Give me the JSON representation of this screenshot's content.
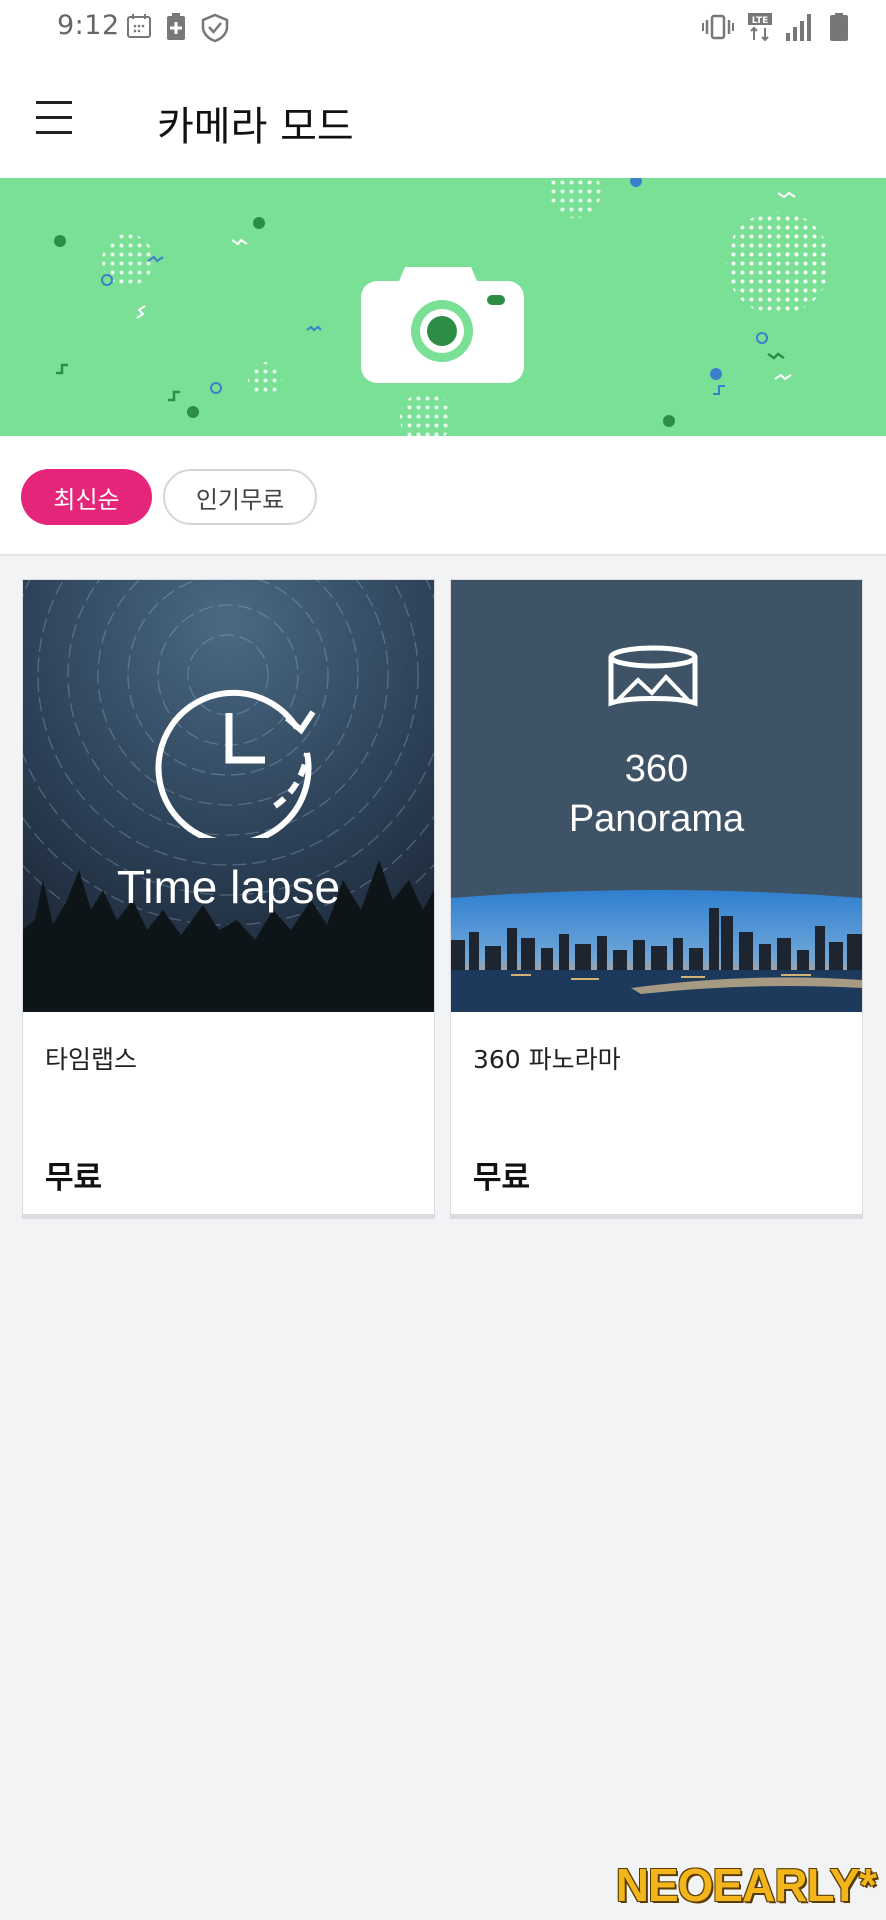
{
  "status_bar": {
    "time": "9:12",
    "left_icons": [
      "calendar-icon",
      "battery-saver-icon",
      "shield-check-icon"
    ],
    "right_icons": [
      "vibrate-icon",
      "lte-icon",
      "signal-icon",
      "battery-icon"
    ]
  },
  "app_bar": {
    "title": "카메라 모드"
  },
  "banner": {
    "background_color": "#79e096",
    "icon": "camera-icon"
  },
  "filters": [
    {
      "label": "최신순",
      "active": true
    },
    {
      "label": "인기무료",
      "active": false
    }
  ],
  "colors": {
    "accent": "#e5257a",
    "banner_green": "#79e096"
  },
  "modes": [
    {
      "title": "타임랩스",
      "price": "무료",
      "thumbnail_text": "Time lapse",
      "thumbnail_icon": "timer-clock-icon"
    },
    {
      "title": "360 파노라마",
      "price": "무료",
      "thumbnail_text_line1": "360",
      "thumbnail_text_line2": "Panorama",
      "thumbnail_icon": "panorama-icon"
    }
  ],
  "watermark": "NEOEARLY*"
}
